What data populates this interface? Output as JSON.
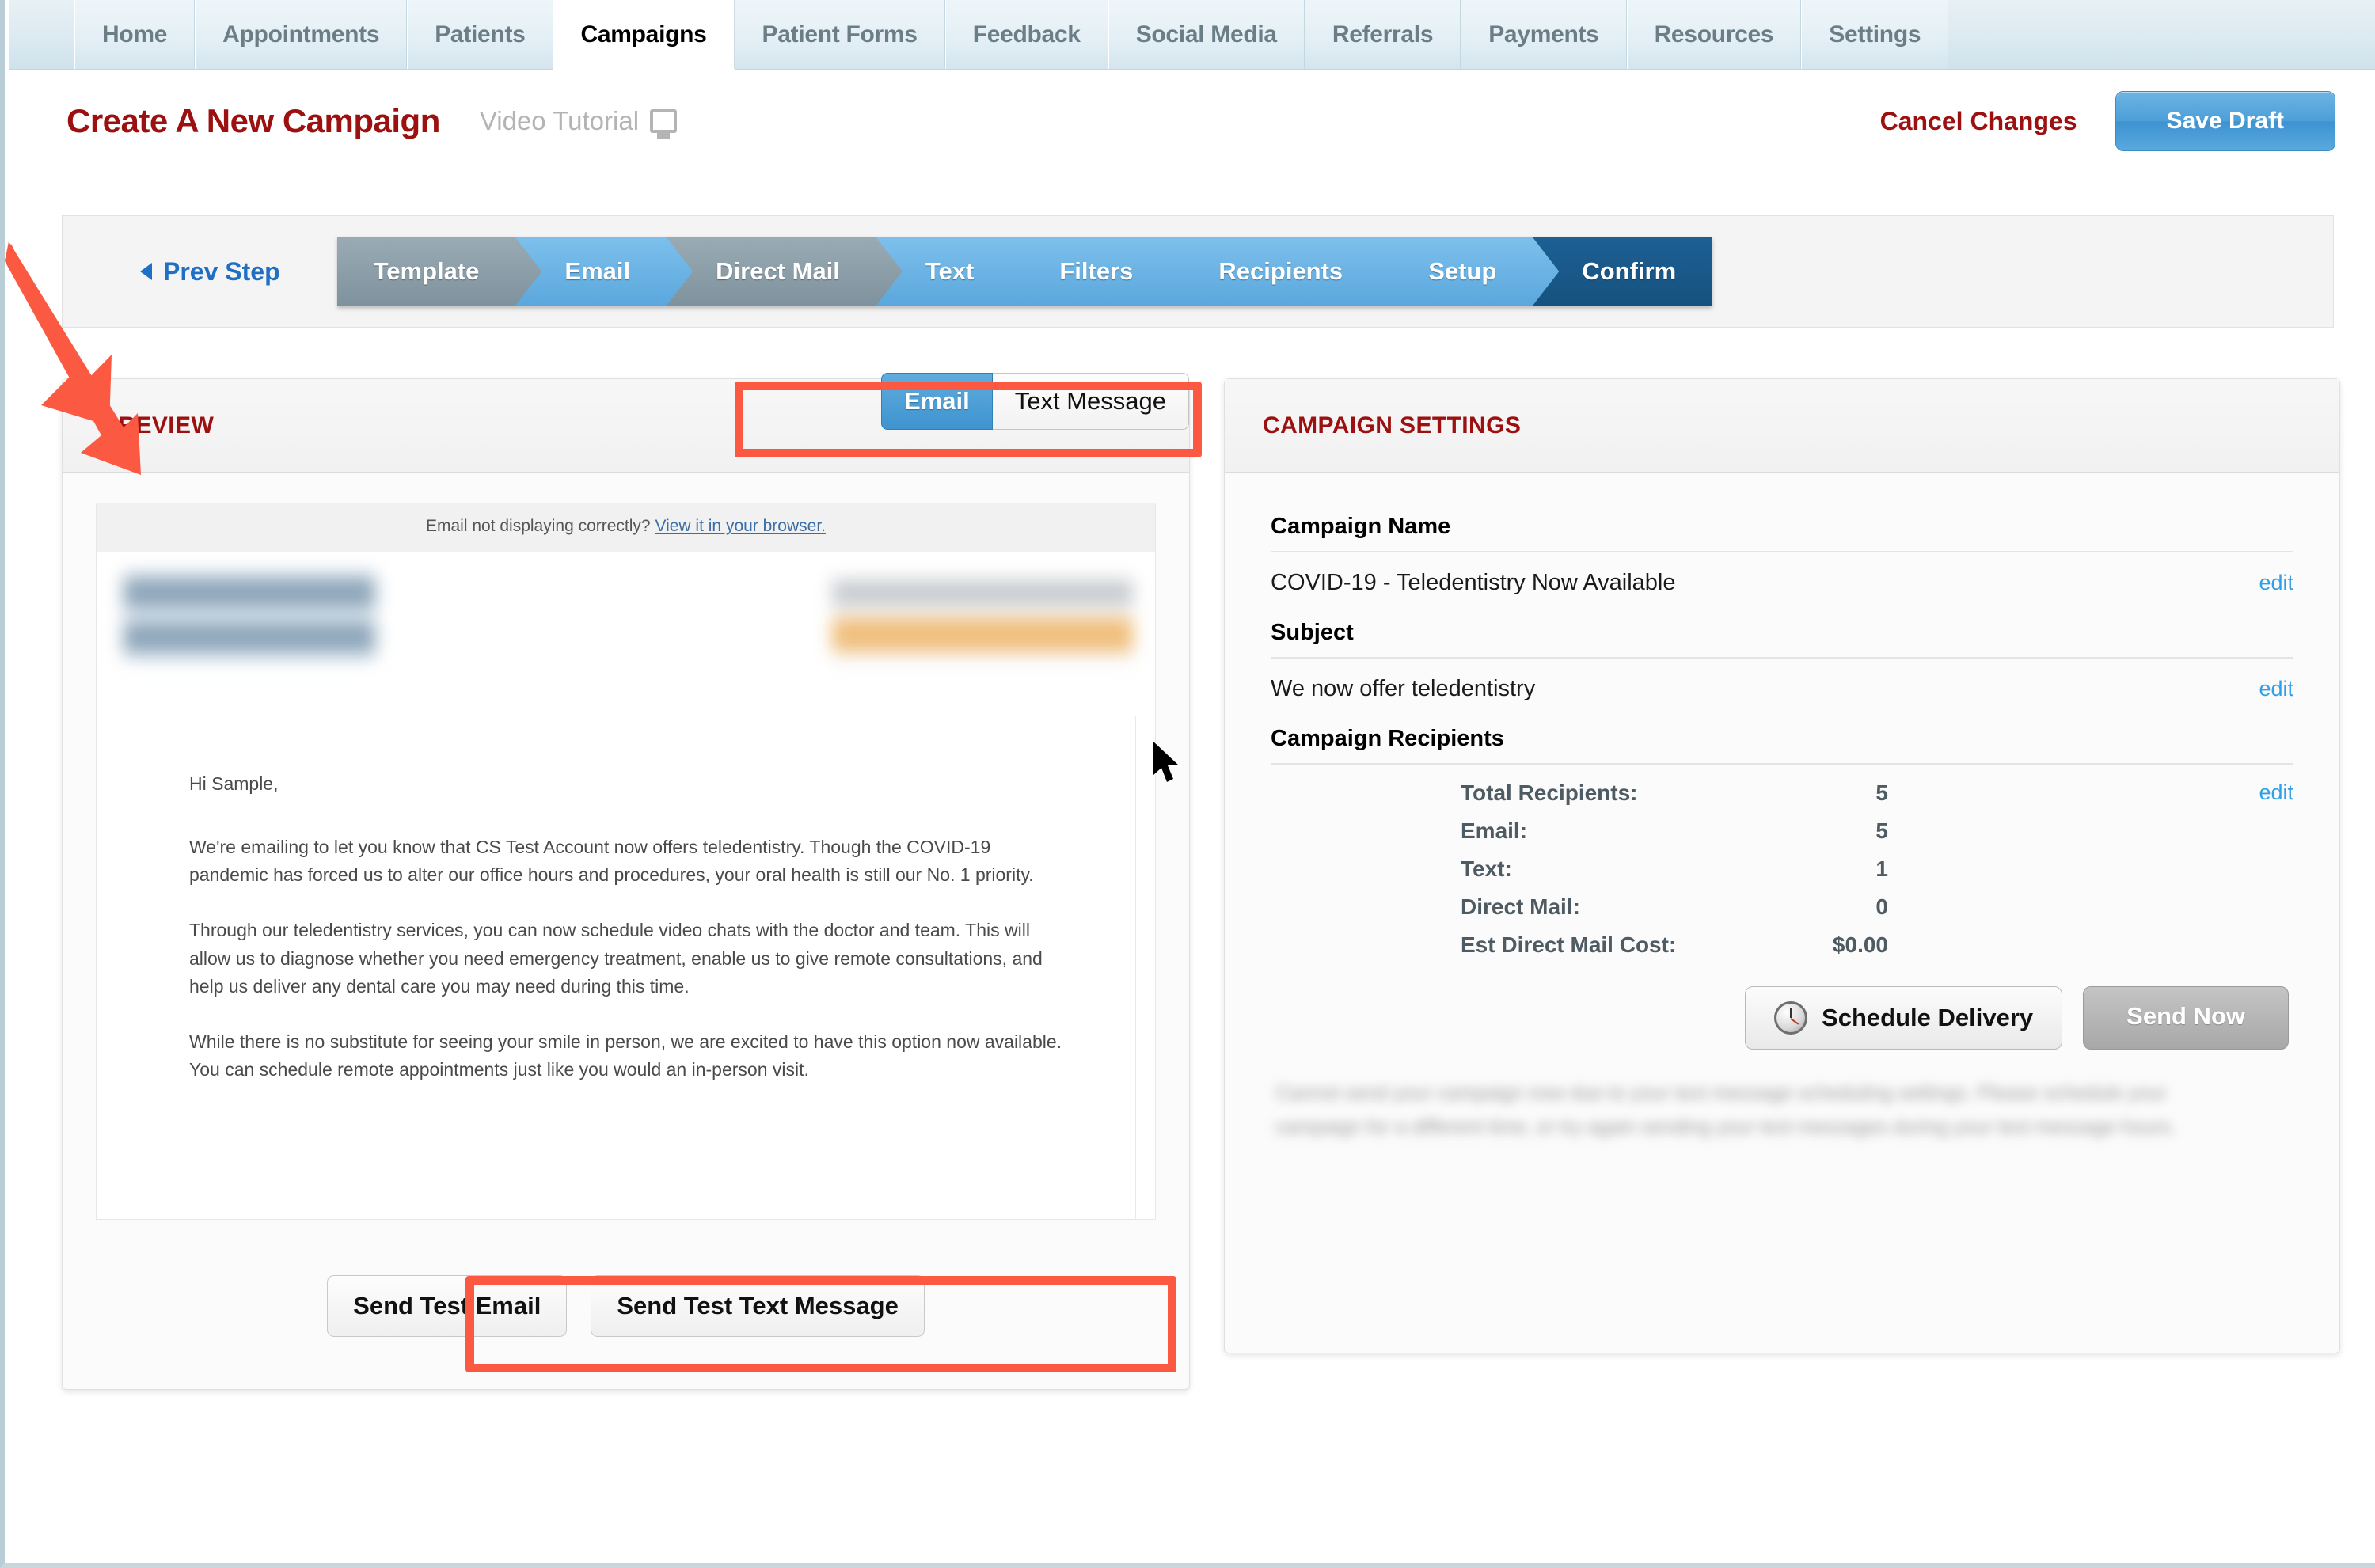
{
  "nav": {
    "tabs": [
      {
        "label": "Home",
        "active": false
      },
      {
        "label": "Appointments",
        "active": false
      },
      {
        "label": "Patients",
        "active": false
      },
      {
        "label": "Campaigns",
        "active": true
      },
      {
        "label": "Patient Forms",
        "active": false
      },
      {
        "label": "Feedback",
        "active": false
      },
      {
        "label": "Social Media",
        "active": false
      },
      {
        "label": "Referrals",
        "active": false
      },
      {
        "label": "Payments",
        "active": false
      },
      {
        "label": "Resources",
        "active": false
      },
      {
        "label": "Settings",
        "active": false
      }
    ]
  },
  "header": {
    "title": "Create A New Campaign",
    "video_tutorial": "Video Tutorial",
    "cancel_label": "Cancel Changes",
    "save_label": "Save Draft"
  },
  "wizard": {
    "prev_step": "Prev Step",
    "steps": [
      {
        "label": "Template",
        "state": "gray"
      },
      {
        "label": "Email",
        "state": "blue"
      },
      {
        "label": "Direct Mail",
        "state": "gray"
      },
      {
        "label": "Text",
        "state": "blue"
      },
      {
        "label": "Filters",
        "state": "blue"
      },
      {
        "label": "Recipients",
        "state": "blue"
      },
      {
        "label": "Setup",
        "state": "blue"
      },
      {
        "label": "Confirm",
        "state": "dark"
      }
    ]
  },
  "preview": {
    "label": "PREVIEW",
    "toggle": {
      "email": "Email",
      "text": "Text Message",
      "selected": "Email"
    },
    "email": {
      "notice_text": "Email not displaying correctly?",
      "notice_link": "View it in your browser.",
      "greeting": "Hi Sample,",
      "paragraphs": [
        "We're emailing to let you know that CS Test Account now offers teledentistry. Though the COVID-19 pandemic has forced us to alter our office hours and procedures, your oral health is still our No. 1 priority.",
        "Through our teledentistry services, you can now schedule video chats with the doctor and team. This will allow us to diagnose whether you need emergency treatment, enable us to give remote consultations, and help us deliver any dental care you may need during this time.",
        "While there is no substitute for seeing your smile in person, we are excited to have this option now available. You can schedule remote appointments just like you would an in-person visit."
      ]
    },
    "test_email_label": "Send Test Email",
    "test_text_label": "Send Test Text Message"
  },
  "settings": {
    "label": "CAMPAIGN SETTINGS",
    "campaign_name_label": "Campaign Name",
    "campaign_name_value": "COVID-19 - Teledentistry Now Available",
    "subject_label": "Subject",
    "subject_value": "We now offer teledentistry",
    "recipients_label": "Campaign Recipients",
    "edit_label": "edit",
    "recipient_rows": [
      {
        "key": "Total Recipients:",
        "value": "5"
      },
      {
        "key": "Email:",
        "value": "5"
      },
      {
        "key": "Text:",
        "value": "1"
      },
      {
        "key": "Direct Mail:",
        "value": "0"
      },
      {
        "key": "Est Direct Mail Cost:",
        "value": "$0.00"
      }
    ],
    "schedule_label": "Schedule Delivery",
    "send_now_label": "Send Now",
    "disclaimer": "Cannot send your campaign now due to your text message scheduling settings. Please schedule your campaign for a different time, or try again sending your text messages during your text message hours."
  },
  "colors": {
    "brand_red": "#9c1010",
    "link_blue": "#2ea0e8",
    "accent_blue": "#4d9fd8",
    "active_step": "#16527f",
    "highlight": "#fb5941"
  }
}
